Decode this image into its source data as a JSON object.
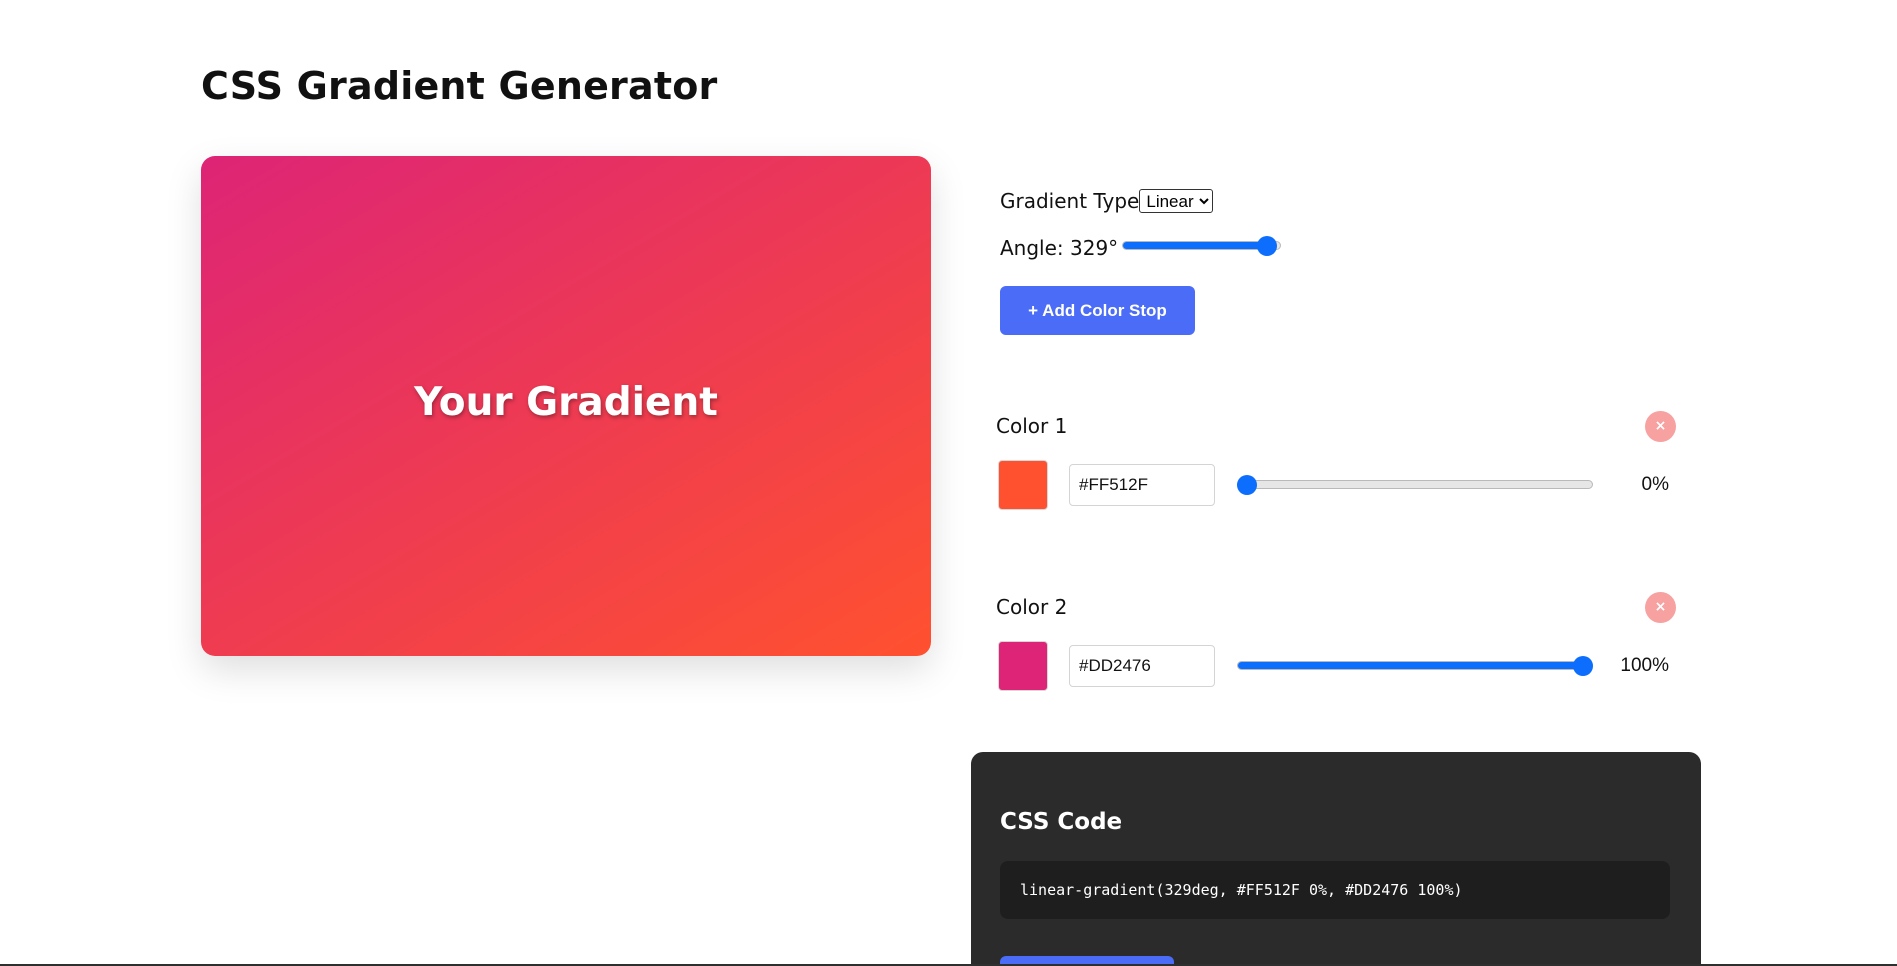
{
  "header": {
    "title": "CSS Gradient Generator"
  },
  "preview": {
    "label": "Your Gradient",
    "gradient_css": "linear-gradient(329deg, #FF512F 0%, #DD2476 100%)"
  },
  "controls": {
    "type_label": "Gradient Type",
    "type_selected": "Linear",
    "angle_label": "Angle: 329°",
    "angle_value": 329,
    "angle_max": 360,
    "add_stop_label": "+ Add Color Stop"
  },
  "stops": [
    {
      "label": "Color 1",
      "color": "#FF512F",
      "hex": "#FF512F",
      "position": 0,
      "position_text": "0%",
      "remove_label": "×"
    },
    {
      "label": "Color 2",
      "color": "#DD2476",
      "hex": "#DD2476",
      "position": 100,
      "position_text": "100%",
      "remove_label": "×"
    }
  ],
  "code": {
    "title": "CSS Code",
    "value": "linear-gradient(329deg, #FF512F 0%, #DD2476 100%)"
  },
  "colors": {
    "accent": "#4A6CF7",
    "slider": "#0D6EFD",
    "remove": "#F7A1A1",
    "code_panel": "#2B2B2B"
  }
}
